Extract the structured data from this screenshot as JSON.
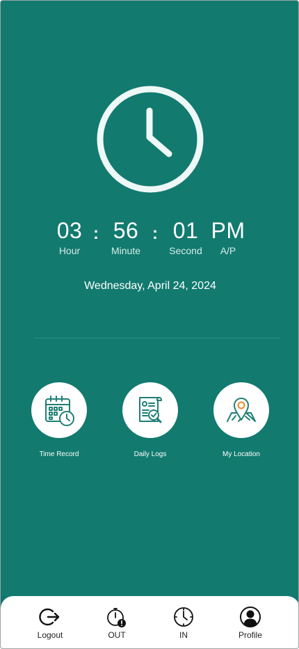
{
  "clock": {
    "hour": "03",
    "minute": "56",
    "second": "01",
    "ampm": "PM",
    "separator": ":",
    "hour_label": "Hour",
    "minute_label": "Minute",
    "second_label": "Second",
    "ampm_label": "A/P"
  },
  "date": "Wednesday, April 24, 2024",
  "actions": [
    {
      "label": "Time Record",
      "icon": "calendar-clock-icon"
    },
    {
      "label": "Daily Logs",
      "icon": "document-search-icon"
    },
    {
      "label": "My Location",
      "icon": "map-pin-icon"
    }
  ],
  "nav": [
    {
      "label": "Logout",
      "icon": "logout-icon"
    },
    {
      "label": "OUT",
      "icon": "stopwatch-alert-icon"
    },
    {
      "label": "IN",
      "icon": "clock-icon"
    },
    {
      "label": "Profile",
      "icon": "user-circle-icon"
    }
  ],
  "colors": {
    "background": "#127a6f",
    "icon_teal": "#1f7f74",
    "pin_orange": "#f08a24",
    "nav_background": "#ffffff"
  }
}
